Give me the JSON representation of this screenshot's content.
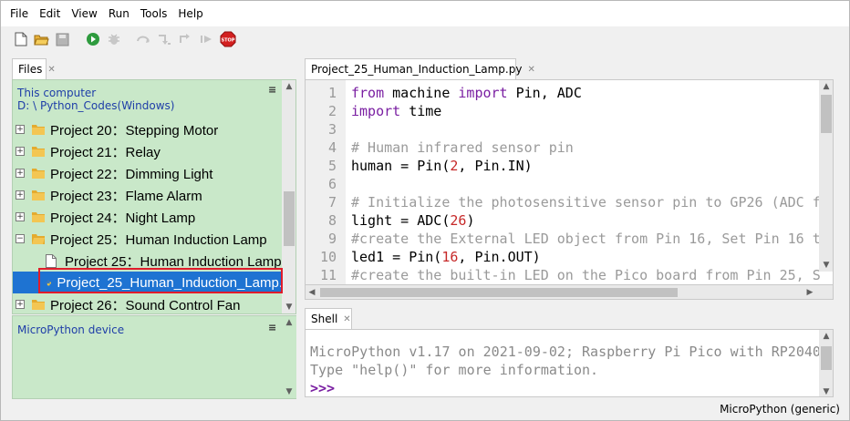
{
  "menu": [
    "File",
    "Edit",
    "View",
    "Run",
    "Tools",
    "Help"
  ],
  "toolbar": {
    "icons": [
      "new-file-icon",
      "open-folder-icon",
      "save-icon",
      "run-icon",
      "debug-icon",
      "step-over-icon",
      "step-into-icon",
      "step-out-icon",
      "resume-icon",
      "stop-icon"
    ],
    "stop_label": "STOP"
  },
  "files": {
    "tab_label": "Files",
    "location_title": "This computer",
    "location_path": "D: \\ Python_Codes(Windows)",
    "items": [
      {
        "label": "Project 20：Stepping Motor",
        "type": "folder",
        "state": "collapsed"
      },
      {
        "label": "Project 21：Relay",
        "type": "folder",
        "state": "collapsed"
      },
      {
        "label": "Project 22：Dimming Light",
        "type": "folder",
        "state": "collapsed"
      },
      {
        "label": "Project 23：Flame Alarm",
        "type": "folder",
        "state": "collapsed"
      },
      {
        "label": "Project 24：Night Lamp",
        "type": "folder",
        "state": "collapsed"
      },
      {
        "label": "Project 25：Human  Induction Lamp",
        "type": "folder",
        "state": "expanded"
      },
      {
        "label": "Project 25：Human Induction Lamp",
        "type": "file",
        "state": "none"
      },
      {
        "label": "Project_25_Human_Induction_Lamp.",
        "type": "python-file",
        "state": "selected"
      },
      {
        "label": "Project 26：Sound Control Fan",
        "type": "folder",
        "state": "collapsed"
      }
    ],
    "device_title": "MicroPython device"
  },
  "editor": {
    "tab_label": "Project_25_Human_Induction_Lamp.py",
    "lines": [
      {
        "n": "1",
        "parts": [
          [
            "kw",
            "from"
          ],
          [
            "",
            " machine "
          ],
          [
            "kw",
            "import"
          ],
          [
            "",
            " Pin, ADC"
          ]
        ]
      },
      {
        "n": "2",
        "parts": [
          [
            "kw",
            "import"
          ],
          [
            "",
            " time"
          ]
        ]
      },
      {
        "n": "3",
        "parts": []
      },
      {
        "n": "4",
        "parts": [
          [
            "cm",
            "# Human infrared sensor pin"
          ]
        ]
      },
      {
        "n": "5",
        "parts": [
          [
            "",
            "human = Pin("
          ],
          [
            "nm",
            "2"
          ],
          [
            "",
            ", Pin.IN)"
          ]
        ]
      },
      {
        "n": "6",
        "parts": []
      },
      {
        "n": "7",
        "parts": [
          [
            "cm",
            "# Initialize the photosensitive sensor pin to GP26 (ADC f"
          ]
        ]
      },
      {
        "n": "8",
        "parts": [
          [
            "",
            "light = ADC("
          ],
          [
            "nm",
            "26"
          ],
          [
            "",
            ")"
          ]
        ]
      },
      {
        "n": "9",
        "parts": [
          [
            "cm",
            "#create the External LED object from Pin 16, Set Pin 16 t"
          ]
        ]
      },
      {
        "n": "10",
        "parts": [
          [
            "",
            "led1 = Pin("
          ],
          [
            "nm",
            "16"
          ],
          [
            "",
            ", Pin.OUT)"
          ]
        ]
      },
      {
        "n": "11",
        "parts": [
          [
            "cm",
            "#create the built-in LED on the Pico board from Pin 25, S"
          ]
        ]
      }
    ]
  },
  "shell": {
    "tab_label": "Shell",
    "lines": [
      "MicroPython v1.17 on 2021-09-02; Raspberry Pi Pico with RP2040",
      "Type \"help()\" for more information."
    ],
    "prompt": ">>>"
  },
  "status": {
    "interpreter": "MicroPython (generic)"
  },
  "colors": {
    "files_bg": "#c9e8c9",
    "selection": "#1e73d2",
    "highlight_outline": "#e01c2b",
    "keyword": "#7a1fa2",
    "comment": "#9a9a9a",
    "number": "#c62828"
  }
}
